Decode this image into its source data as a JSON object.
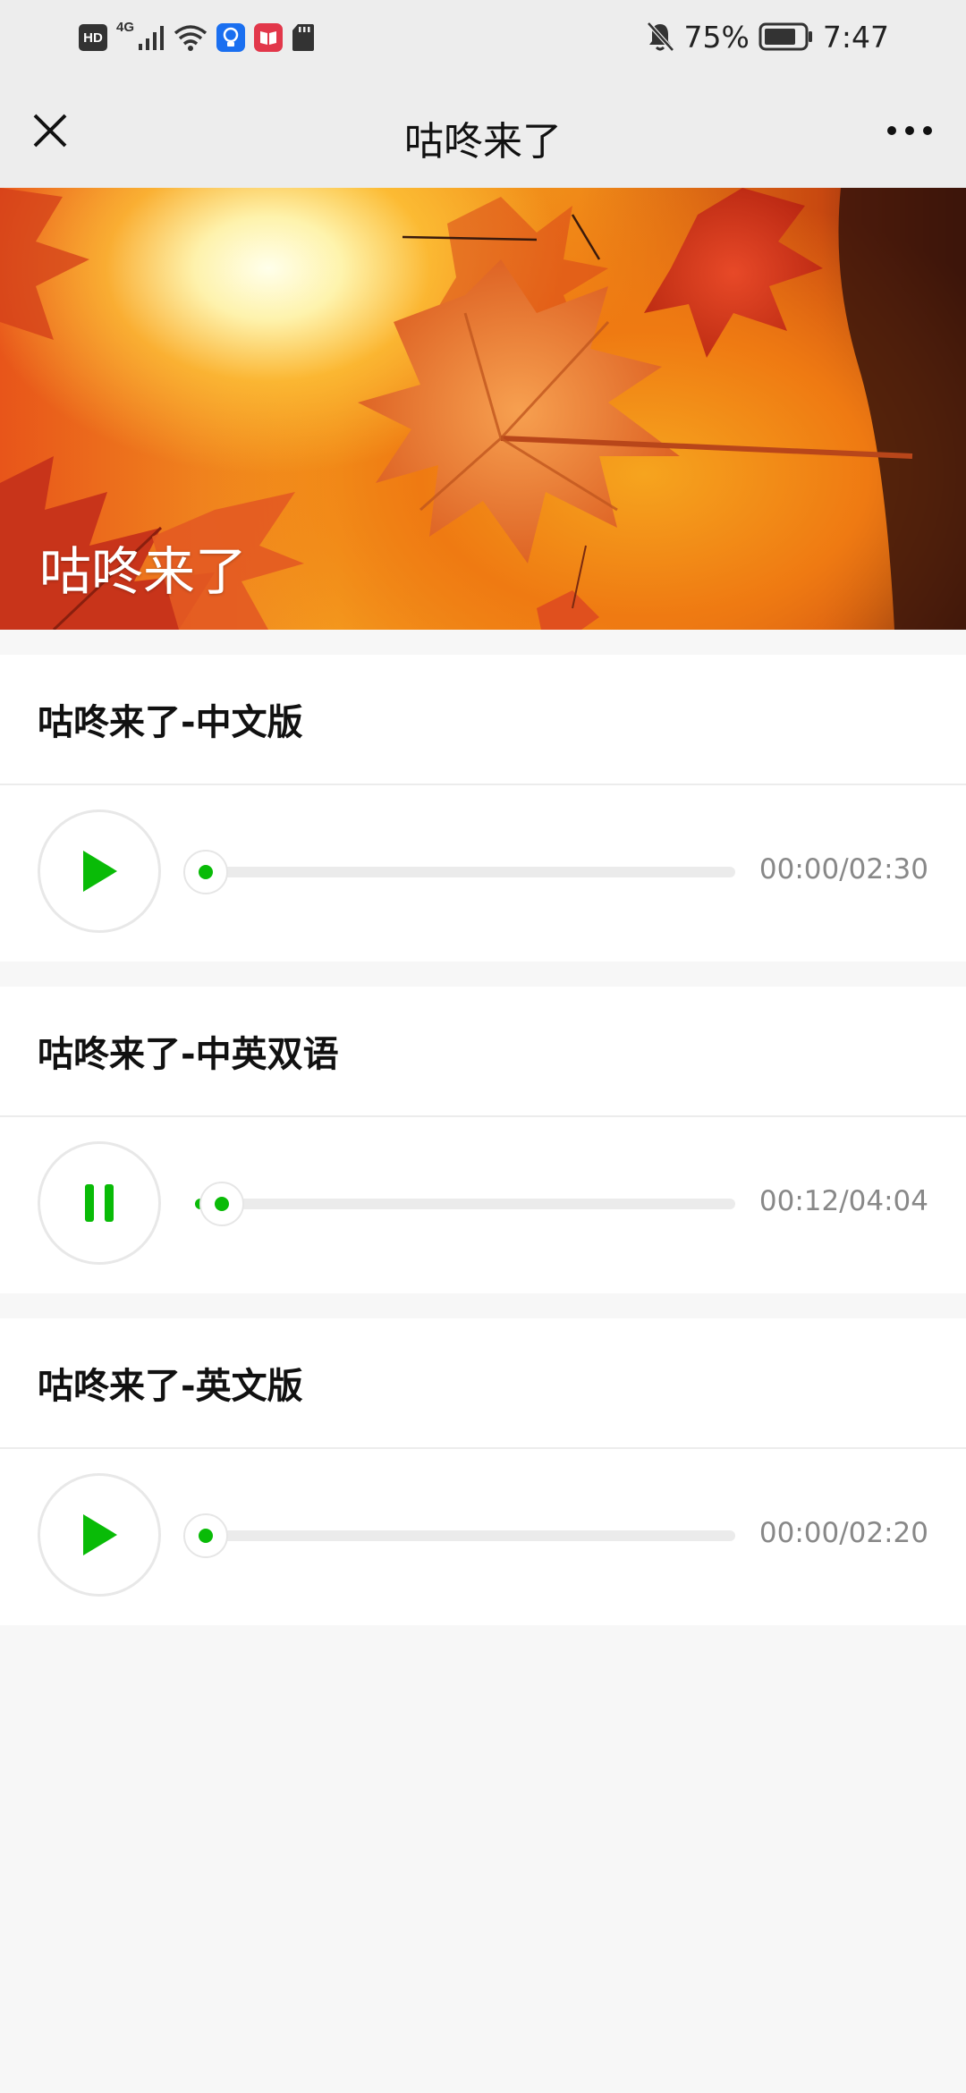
{
  "status_bar": {
    "network": "4G",
    "battery": "75%",
    "time": "7:47",
    "icons": [
      "hd-icon",
      "signal-icon",
      "wifi-icon",
      "bulb-app-icon",
      "book-app-icon",
      "sd-card-icon",
      "mute-bell-icon",
      "battery-icon"
    ]
  },
  "nav": {
    "title": "咕咚来了",
    "close_icon": "close-icon",
    "more_icon": "more-icon"
  },
  "banner": {
    "caption": "咕咚来了"
  },
  "tracks": [
    {
      "title": "咕咚来了-中文版",
      "state": "paused",
      "time": "00:00/02:30",
      "progress": 0.0
    },
    {
      "title": "咕咚来了-中英双语",
      "state": "playing",
      "time": "00:12/04:04",
      "progress": 0.05
    },
    {
      "title": "咕咚来了-英文版",
      "state": "paused",
      "time": "00:00/02:20",
      "progress": 0.0
    }
  ],
  "colors": {
    "accent": "#09bb07",
    "nav_bg": "#ededed",
    "page_bg": "#f7f7f7"
  }
}
